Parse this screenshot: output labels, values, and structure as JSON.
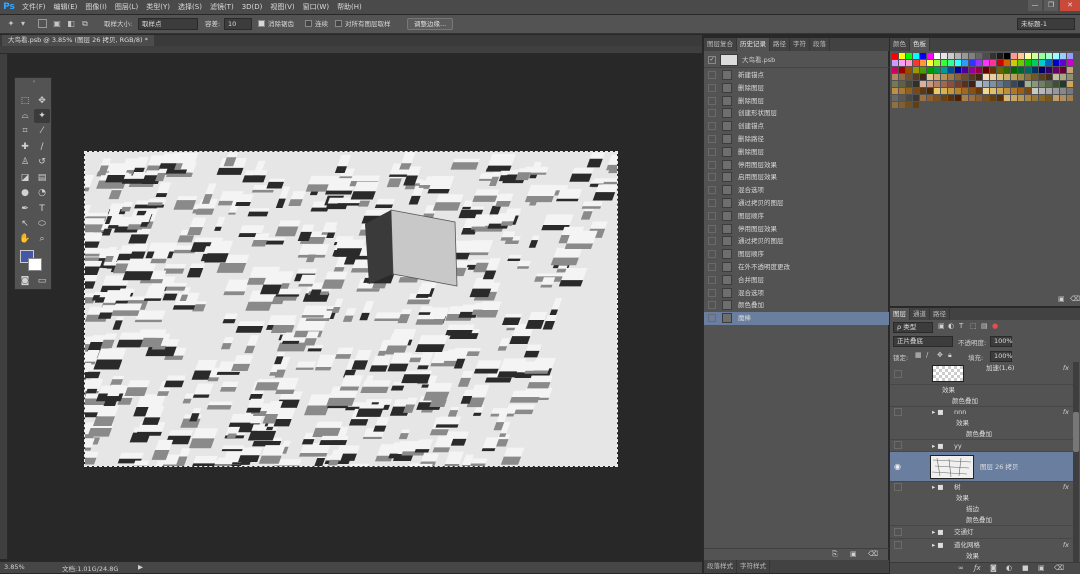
{
  "menubar": {
    "logo": "Ps",
    "items": [
      "文件(F)",
      "编辑(E)",
      "图像(I)",
      "图层(L)",
      "类型(Y)",
      "选择(S)",
      "滤镜(T)",
      "3D(D)",
      "视图(V)",
      "窗口(W)",
      "帮助(H)"
    ],
    "controls": [
      "—",
      "❐",
      "✕"
    ]
  },
  "options": {
    "sample_size_label": "取样大小:",
    "sample_size_value": "取样点",
    "tolerance_label": "容差:",
    "tolerance_value": "10",
    "antialias_label": "消除锯齿",
    "contiguous_label": "连续",
    "sample_all_label": "对所有图层取样",
    "refine_edge_button": "调整边缘...",
    "workspace": "未标题-1"
  },
  "document": {
    "tab_title": "大鸟看.psb @ 3.85% (图层 26 拷贝, RGB/8) *",
    "status_zoom": "3.85%",
    "status_doc": "文档:1.01G/24.8G"
  },
  "history": {
    "tabs": [
      "图层复合",
      "历史记录",
      "路径",
      "字符",
      "段落"
    ],
    "snapshot_label": "大鸟看.psb",
    "items": [
      "新建锚点",
      "删除图层",
      "删除图层",
      "创建形状图层",
      "创建锚点",
      "删除路径",
      "删除图层",
      "停用图层效果",
      "启用图层效果",
      "混合选项",
      "通过拷贝的图层",
      "图层顺序",
      "停用图层效果",
      "通过拷贝的图层",
      "图层顺序",
      "在外不透明度更改",
      "合并图层",
      "混合选项",
      "颜色叠加",
      "魔棒"
    ],
    "bottom_tabs": [
      "段落样式",
      "字符样式"
    ]
  },
  "swatches": {
    "tabs": [
      "颜色",
      "色板"
    ],
    "colors": [
      "#ff0000",
      "#ffff00",
      "#00ff00",
      "#00ffff",
      "#0000ff",
      "#ff00ff",
      "#ffffff",
      "#e6e6e6",
      "#cccccc",
      "#b3b3b3",
      "#999999",
      "#808080",
      "#666666",
      "#4d4d4d",
      "#333333",
      "#1a1a1a",
      "#000000",
      "#ff9999",
      "#ffcc99",
      "#ffff99",
      "#ccff99",
      "#99ff99",
      "#99ffcc",
      "#99ffff",
      "#99ccff",
      "#9999ff",
      "#cc99ff",
      "#ff99ff",
      "#ff99cc",
      "#ff3333",
      "#ff9933",
      "#ffff33",
      "#99ff33",
      "#33ff33",
      "#33ff99",
      "#33ffff",
      "#3399ff",
      "#3333ff",
      "#9933ff",
      "#ff33ff",
      "#ff3399",
      "#cc0000",
      "#cc6600",
      "#cccc00",
      "#66cc00",
      "#00cc00",
      "#00cc66",
      "#00cccc",
      "#0066cc",
      "#0000cc",
      "#6600cc",
      "#cc00cc",
      "#cc0066",
      "#990000",
      "#994c00",
      "#999900",
      "#4c9900",
      "#009900",
      "#00994c",
      "#009999",
      "#004c99",
      "#000099",
      "#4c0099",
      "#990099",
      "#99004c",
      "#660000",
      "#663300",
      "#666600",
      "#336600",
      "#006600",
      "#006633",
      "#006666",
      "#003366",
      "#000066",
      "#330066",
      "#660066",
      "#660033",
      "#c8a27a",
      "#b08860",
      "#8c6a46",
      "#6e5034",
      "#543a24",
      "#3c2818",
      "#e0c090",
      "#d0a870",
      "#b89058",
      "#a07848",
      "#886038",
      "#704c2c",
      "#583820",
      "#402814",
      "#f0e0c0",
      "#e8d0a0",
      "#d8c080",
      "#c8b068",
      "#b8a058",
      "#a08848",
      "#887038",
      "#705828",
      "#584020",
      "#403018",
      "#c0c0a0",
      "#a8a888",
      "#909070",
      "#787858",
      "#606048",
      "#484838",
      "#303028",
      "#d8b0a0",
      "#c89880",
      "#b88068",
      "#a06850",
      "#885040",
      "#704030",
      "#583020",
      "#402018",
      "#b0c0d0",
      "#98a8b8",
      "#8090a0",
      "#687888",
      "#506070",
      "#384858",
      "#203040",
      "#a0b090",
      "#889878",
      "#708060",
      "#586848",
      "#405038",
      "#283828",
      "#d0a850",
      "#c09040",
      "#a87830",
      "#906020",
      "#784818",
      "#603810",
      "#482808",
      "#e8c868",
      "#d8b050",
      "#c89838",
      "#b88028",
      "#a06818",
      "#885010",
      "#703808",
      "#f0d890",
      "#e0c070",
      "#d0a850",
      "#c09038",
      "#b07828",
      "#986018",
      "#804810",
      "#c8c8c8",
      "#b8b8b8",
      "#a8a8a8",
      "#989898",
      "#888888",
      "#787878",
      "#686868",
      "#585858",
      "#484848",
      "#383838",
      "#9c7040",
      "#8c6030",
      "#7c5020",
      "#6c4010",
      "#5c3008",
      "#4c2004",
      "#a88050",
      "#987040",
      "#886030",
      "#785020",
      "#684010",
      "#583008",
      "#d8b878",
      "#c8a868",
      "#b89858",
      "#a88848",
      "#987838",
      "#886828",
      "#785818",
      "#c0a070",
      "#b09060",
      "#a08050",
      "#907040",
      "#806030",
      "#705020",
      "#604010"
    ]
  },
  "layers": {
    "tabs": [
      "图层",
      "通道",
      "路径"
    ],
    "filter_label": "ρ 类型",
    "blend_mode": "正片叠底",
    "opacity_label": "不透明度:",
    "opacity_value": "100%",
    "lock_label": "锁定:",
    "fill_label": "填充:",
    "fill_value": "100%",
    "rows": {
      "r0": {
        "name": "加速(1,6)",
        "fx": "fx"
      },
      "r1": {
        "name": "效果"
      },
      "r2": {
        "name": "颜色叠加"
      },
      "r3": {
        "name": "nnn",
        "fx": "fx"
      },
      "r4": {
        "name": "效果"
      },
      "r5": {
        "name": "颜色叠加"
      },
      "r6": {
        "name": "yy"
      },
      "r7": {
        "name": "图层 26 拷贝"
      },
      "r8": {
        "name": "树",
        "fx": "fx"
      },
      "r9": {
        "name": "效果"
      },
      "r10": {
        "name": "描边"
      },
      "r11": {
        "name": "颜色叠加"
      },
      "r12": {
        "name": "交通灯"
      },
      "r13": {
        "name": "道化网格",
        "fx": "fx"
      },
      "r14": {
        "name": "效果"
      }
    }
  }
}
